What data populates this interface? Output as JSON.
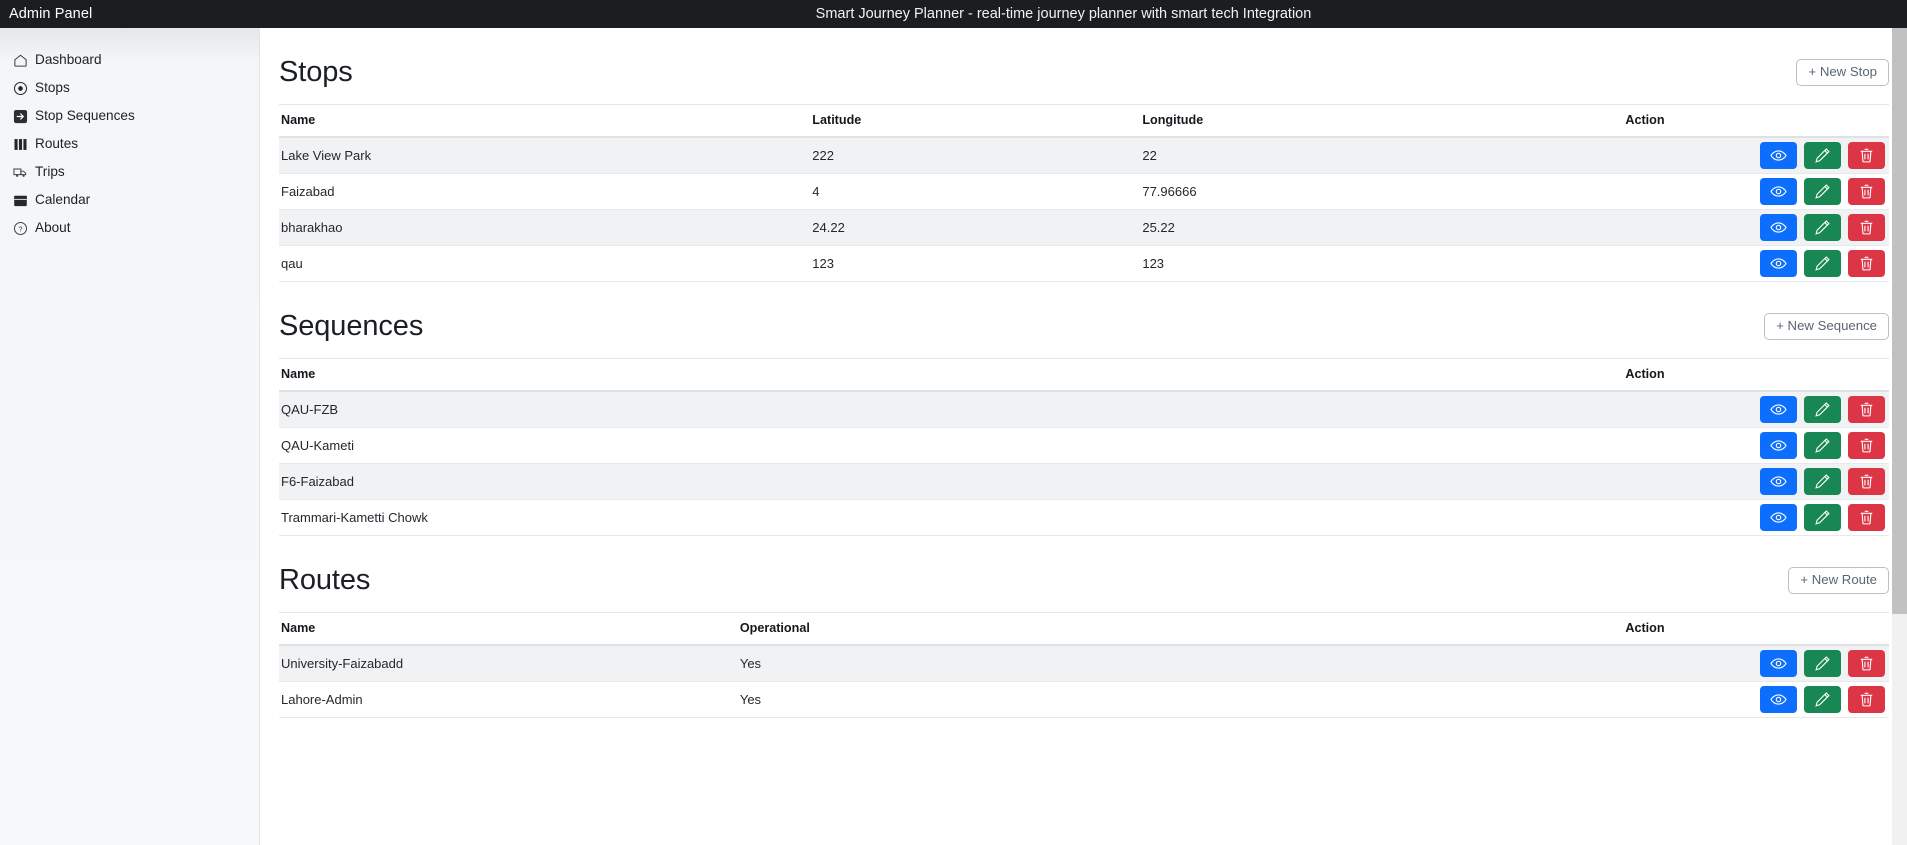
{
  "topbar": {
    "brand": "Admin Panel",
    "title": "Smart Journey Planner - real-time journey planner with smart tech Integration"
  },
  "sidebar": {
    "items": [
      {
        "label": "Dashboard",
        "icon": "home-icon"
      },
      {
        "label": "Stops",
        "icon": "circle-dot-icon"
      },
      {
        "label": "Stop Sequences",
        "icon": "arrow-right-box-icon"
      },
      {
        "label": "Routes",
        "icon": "columns-icon"
      },
      {
        "label": "Trips",
        "icon": "bus-icon"
      },
      {
        "label": "Calendar",
        "icon": "calendar-icon"
      },
      {
        "label": "About",
        "icon": "question-circle-icon"
      }
    ]
  },
  "actions": {
    "view_label": "View",
    "edit_label": "Edit",
    "delete_label": "Delete"
  },
  "colors": {
    "view": "#0d6efd",
    "edit": "#198754",
    "delete": "#dc3545",
    "topbar": "#1a1e21",
    "sidebar": "#f6f8fa"
  },
  "sections": [
    {
      "id": "stops",
      "title": "Stops",
      "new_button": "+ New Stop",
      "columns": [
        "Name",
        "Latitude",
        "Longitude",
        "Action"
      ],
      "rows": [
        {
          "name": "Lake View Park",
          "latitude": "222",
          "longitude": "22"
        },
        {
          "name": "Faizabad",
          "latitude": "4",
          "longitude": "77.96666"
        },
        {
          "name": "bharakhao",
          "latitude": "24.22",
          "longitude": "25.22"
        },
        {
          "name": "qau",
          "latitude": "123",
          "longitude": "123"
        }
      ]
    },
    {
      "id": "sequences",
      "title": "Sequences",
      "new_button": "+ New Sequence",
      "columns": [
        "Name",
        "Action"
      ],
      "rows": [
        {
          "name": "QAU-FZB"
        },
        {
          "name": "QAU-Kameti"
        },
        {
          "name": "F6-Faizabad"
        },
        {
          "name": "Trammari-Kametti Chowk"
        }
      ]
    },
    {
      "id": "routes",
      "title": "Routes",
      "new_button": "+ New Route",
      "columns": [
        "Name",
        "Operational",
        "Action"
      ],
      "rows": [
        {
          "name": "University-Faizabadd",
          "operational": "Yes"
        },
        {
          "name": "Lahore-Admin",
          "operational": "Yes"
        }
      ]
    }
  ]
}
